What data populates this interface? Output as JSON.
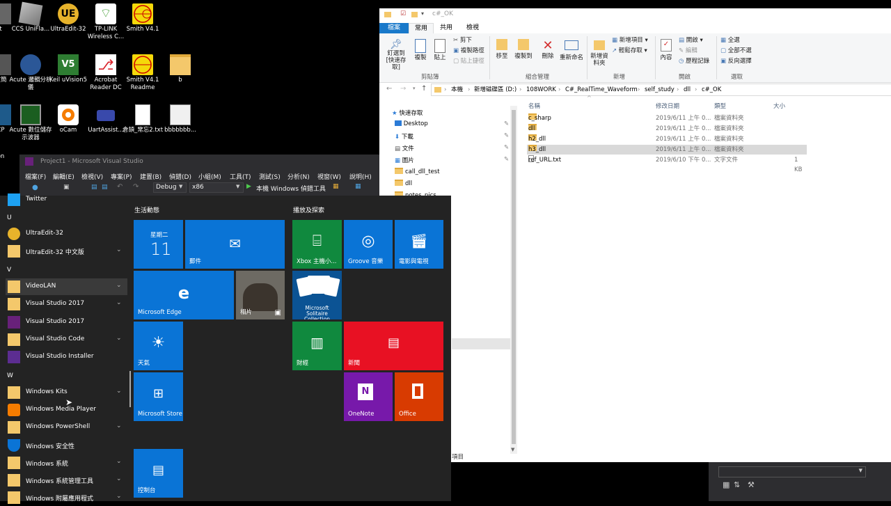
{
  "desktop": {
    "icons": [
      {
        "label": "CCS UniFla..."
      },
      {
        "label": "UltraEdit-32"
      },
      {
        "label": "TP-LINK Wireless C..."
      },
      {
        "label": "Smith V4.1"
      },
      {
        "label": "Acute 邏輯分析儀"
      },
      {
        "label": "Keil uVision5"
      },
      {
        "label": "Acrobat Reader DC"
      },
      {
        "label": "Smith V4.1 Readme"
      },
      {
        "label": "b"
      },
      {
        "label": "Acute 數位儲存示波器"
      },
      {
        "label": "oCam"
      },
      {
        "label": "UartAssist..."
      },
      {
        "label": "倉頡_常忘2.txt"
      },
      {
        "label": "bbbbbbb..."
      },
      {
        "label": "t"
      },
      {
        "label": "故簡"
      },
      {
        "label": "CP"
      },
      {
        "label": "on"
      }
    ]
  },
  "vs": {
    "title": "Project1 - Microsoft Visual Studio",
    "menu": [
      "檔案(F)",
      "編輯(E)",
      "檢視(V)",
      "專案(P)",
      "建置(B)",
      "偵錯(D)",
      "小組(M)",
      "工具(T)",
      "測試(S)",
      "分析(N)",
      "視窗(W)",
      "說明(H)"
    ],
    "config": "Debug",
    "platform": "x86",
    "run_label": "本機 Windows 偵錯工具"
  },
  "explorer": {
    "title": "c#_OK",
    "tabs": [
      "檔案",
      "常用",
      "共用",
      "檢視"
    ],
    "ribbon": {
      "pin": "釘選到 [快速存取]",
      "copy": "複製",
      "paste": "貼上",
      "cut": "剪下",
      "copy_path": "複製路徑",
      "paste_shortcut": "貼上捷徑",
      "move_to": "移至",
      "copy_to": "複製到",
      "delete": "刪除",
      "rename": "重新命名",
      "new_folder": "新增資料夾",
      "new_item": "新增項目",
      "easy_access": "輕鬆存取",
      "properties": "內容",
      "open": "開啟",
      "edit": "編輯",
      "history": "歷程記錄",
      "select_all": "全選",
      "select_none": "全部不選",
      "invert": "反向選擇",
      "groups": [
        "剪貼簿",
        "組合管理",
        "新增",
        "開啟",
        "選取"
      ]
    },
    "breadcrumb": [
      "本機",
      "新增磁碟區 (D:)",
      "108WORK",
      "C#_RealTime_Waveform",
      "self_study",
      "dll",
      "c#_OK"
    ],
    "nav": [
      "快速存取",
      "Desktop",
      "下載",
      "文件",
      "圖片",
      "call_dll_test",
      "dll",
      "notes_pics"
    ],
    "columns": [
      "名稱",
      "修改日期",
      "類型",
      "大小"
    ],
    "files": [
      {
        "name": "c_sharp",
        "date": "2019/6/11 上午 0...",
        "type": "檔案資料夾",
        "size": ""
      },
      {
        "name": "dll",
        "date": "2019/6/11 上午 0...",
        "type": "檔案資料夾",
        "size": ""
      },
      {
        "name": "h2_dll",
        "date": "2019/6/11 上午 0...",
        "type": "檔案資料夾",
        "size": ""
      },
      {
        "name": "h3_dll",
        "date": "2019/6/11 上午 0...",
        "type": "檔案資料夾",
        "size": ""
      },
      {
        "name": "ref_URL.txt",
        "date": "2019/6/10 下午 0...",
        "type": "文字文件",
        "size": "1 KB"
      }
    ],
    "status": "項目"
  },
  "start": {
    "apps": [
      {
        "label": "Twitter"
      },
      {
        "letter": "U"
      },
      {
        "label": "UltraEdit-32"
      },
      {
        "label": "UltraEdit-32 中文版"
      },
      {
        "letter": "V"
      },
      {
        "label": "VideoLAN"
      },
      {
        "label": "Visual Studio 2017"
      },
      {
        "label": "Visual Studio 2017"
      },
      {
        "label": "Visual Studio Code"
      },
      {
        "label": "Visual Studio Installer"
      },
      {
        "letter": "W"
      },
      {
        "label": "Windows Kits"
      },
      {
        "label": "Windows Media Player"
      },
      {
        "label": "Windows PowerShell"
      },
      {
        "label": "Windows 安全性"
      },
      {
        "label": "Windows 系統"
      },
      {
        "label": "Windows 系統管理工具"
      },
      {
        "label": "Windows 附屬應用程式"
      }
    ],
    "group1": "生活動態",
    "group2": "播放及探索",
    "tiles": {
      "calendar_day": "星期二",
      "calendar_date": "11",
      "mail": "郵件",
      "edge": "Microsoft Edge",
      "photos": "相片",
      "weather": "天氣",
      "store": "Microsoft Store",
      "control": "控制台",
      "xbox": "Xbox 主機小...",
      "groove": "Groove 音樂",
      "movies": "電影與電視",
      "solitaire": "Microsoft Solitaire Collection",
      "finance": "財經",
      "news": "新聞",
      "onenote": "OneNote",
      "office": "Office"
    }
  },
  "colors": {
    "tile_blue": "#0a74d6",
    "tile_green": "#10893e",
    "tile_red": "#e81123",
    "tile_purple": "#7719aa",
    "tile_orange": "#d83b01"
  }
}
